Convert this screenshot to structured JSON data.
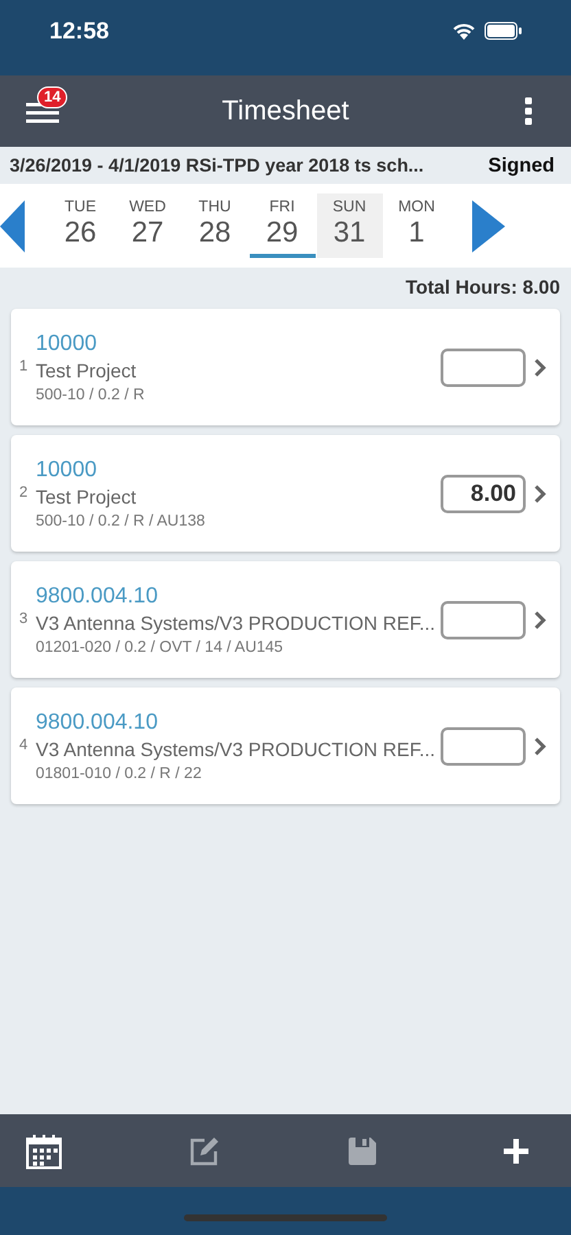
{
  "status_bar": {
    "time": "12:58"
  },
  "header": {
    "title": "Timesheet",
    "badge": "14"
  },
  "period": {
    "label": "3/26/2019 - 4/1/2019 RSi-TPD year 2018 ts sch...",
    "status": "Signed"
  },
  "days": [
    {
      "weekday": "TUE",
      "day": "26",
      "selected": false,
      "highlighted": false
    },
    {
      "weekday": "WED",
      "day": "27",
      "selected": false,
      "highlighted": false
    },
    {
      "weekday": "THU",
      "day": "28",
      "selected": false,
      "highlighted": false
    },
    {
      "weekday": "FRI",
      "day": "29",
      "selected": true,
      "highlighted": false
    },
    {
      "weekday": "SUN",
      "day": "31",
      "selected": false,
      "highlighted": true
    },
    {
      "weekday": "MON",
      "day": "1",
      "selected": false,
      "highlighted": false
    }
  ],
  "total_hours": "Total Hours: 8.00",
  "entries": [
    {
      "index": "1",
      "code": "10000",
      "name": "Test Project",
      "detail": "500-10 / 0.2 / R"
    },
    {
      "index": "2",
      "code": "10000",
      "name": "Test Project",
      "detail": "500-10 / 0.2 / R / AU138",
      "hours": "8.00"
    },
    {
      "index": "3",
      "code": "9800.004.10",
      "name": "V3 Antenna Systems/V3 PRODUCTION REF...",
      "detail": "01201-020 / 0.2 / OVT / 14 / AU145"
    },
    {
      "index": "4",
      "code": "9800.004.10",
      "name": "V3 Antenna Systems/V3 PRODUCTION REF...",
      "detail": "01801-010 / 0.2 / R / 22"
    }
  ],
  "toolbar": [
    {
      "kind": "calendar",
      "disabled": false
    },
    {
      "kind": "edit",
      "disabled": true
    },
    {
      "kind": "save",
      "disabled": true
    },
    {
      "kind": "add",
      "disabled": false
    }
  ]
}
